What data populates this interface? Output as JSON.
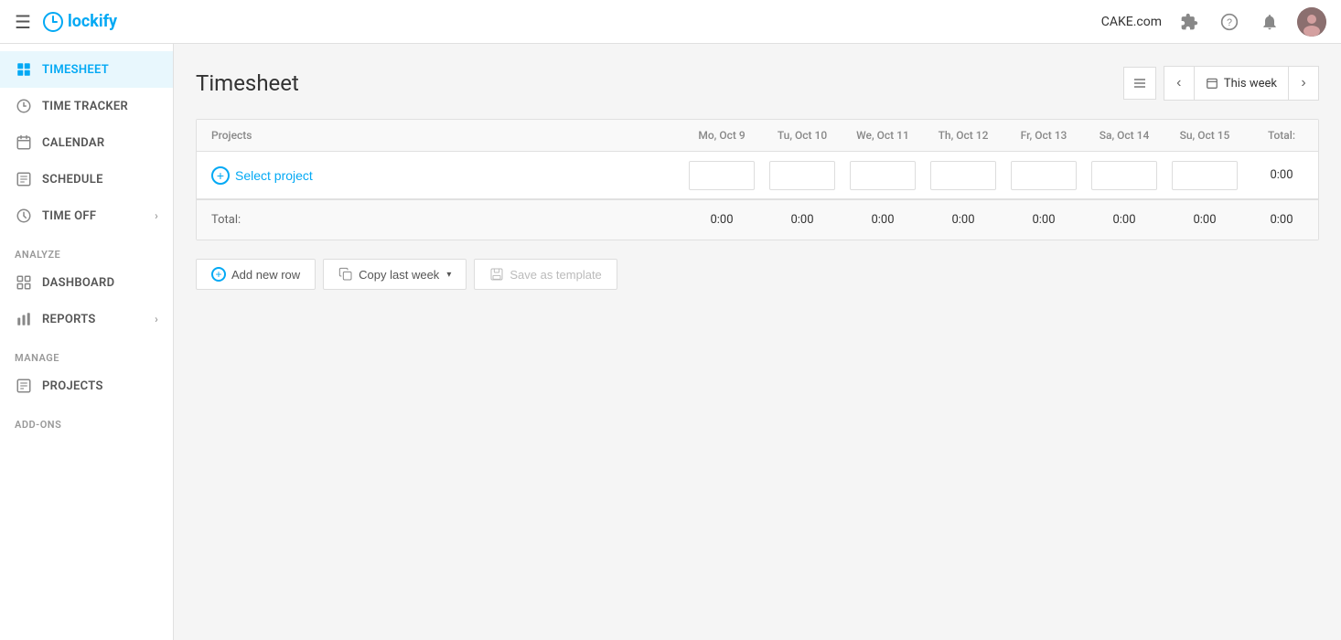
{
  "topbar": {
    "hamburger_label": "☰",
    "logo_text": "lockify",
    "company": "CAKE.com",
    "help_icon": "?",
    "bell_icon": "🔔",
    "avatar_text": "👤"
  },
  "sidebar": {
    "items": [
      {
        "id": "timesheet",
        "label": "TIMESHEET",
        "icon": "grid",
        "active": true
      },
      {
        "id": "time-tracker",
        "label": "TIME TRACKER",
        "icon": "clock"
      },
      {
        "id": "calendar",
        "label": "CALENDAR",
        "icon": "calendar"
      },
      {
        "id": "schedule",
        "label": "SCHEDULE",
        "icon": "schedule"
      },
      {
        "id": "time-off",
        "label": "TIME OFF",
        "icon": "timeoff",
        "hasChevron": true
      }
    ],
    "sections": [
      {
        "label": "ANALYZE",
        "items": [
          {
            "id": "dashboard",
            "label": "DASHBOARD",
            "icon": "dashboard"
          },
          {
            "id": "reports",
            "label": "REPORTS",
            "icon": "reports",
            "hasChevron": true
          }
        ]
      },
      {
        "label": "MANAGE",
        "items": [
          {
            "id": "projects",
            "label": "PROJECTS",
            "icon": "projects"
          }
        ]
      },
      {
        "label": "ADD-ONS",
        "items": []
      }
    ]
  },
  "main": {
    "title": "Timesheet",
    "week_label": "This week",
    "table": {
      "columns": [
        "Projects",
        "Mo, Oct 9",
        "Tu, Oct 10",
        "We, Oct 11",
        "Th, Oct 12",
        "Fr, Oct 13",
        "Sa, Oct 14",
        "Su, Oct 15",
        "Total:"
      ],
      "rows": [
        {
          "project_placeholder": "Select project",
          "values": [
            "",
            "",
            "",
            "",
            "",
            "",
            ""
          ],
          "total": "0:00"
        }
      ],
      "totals": {
        "label": "Total:",
        "values": [
          "0:00",
          "0:00",
          "0:00",
          "0:00",
          "0:00",
          "0:00",
          "0:00",
          "0:00"
        ]
      }
    },
    "buttons": {
      "add_row": "Add new row",
      "copy_last_week": "Copy last week",
      "save_as_template": "Save as template"
    }
  }
}
